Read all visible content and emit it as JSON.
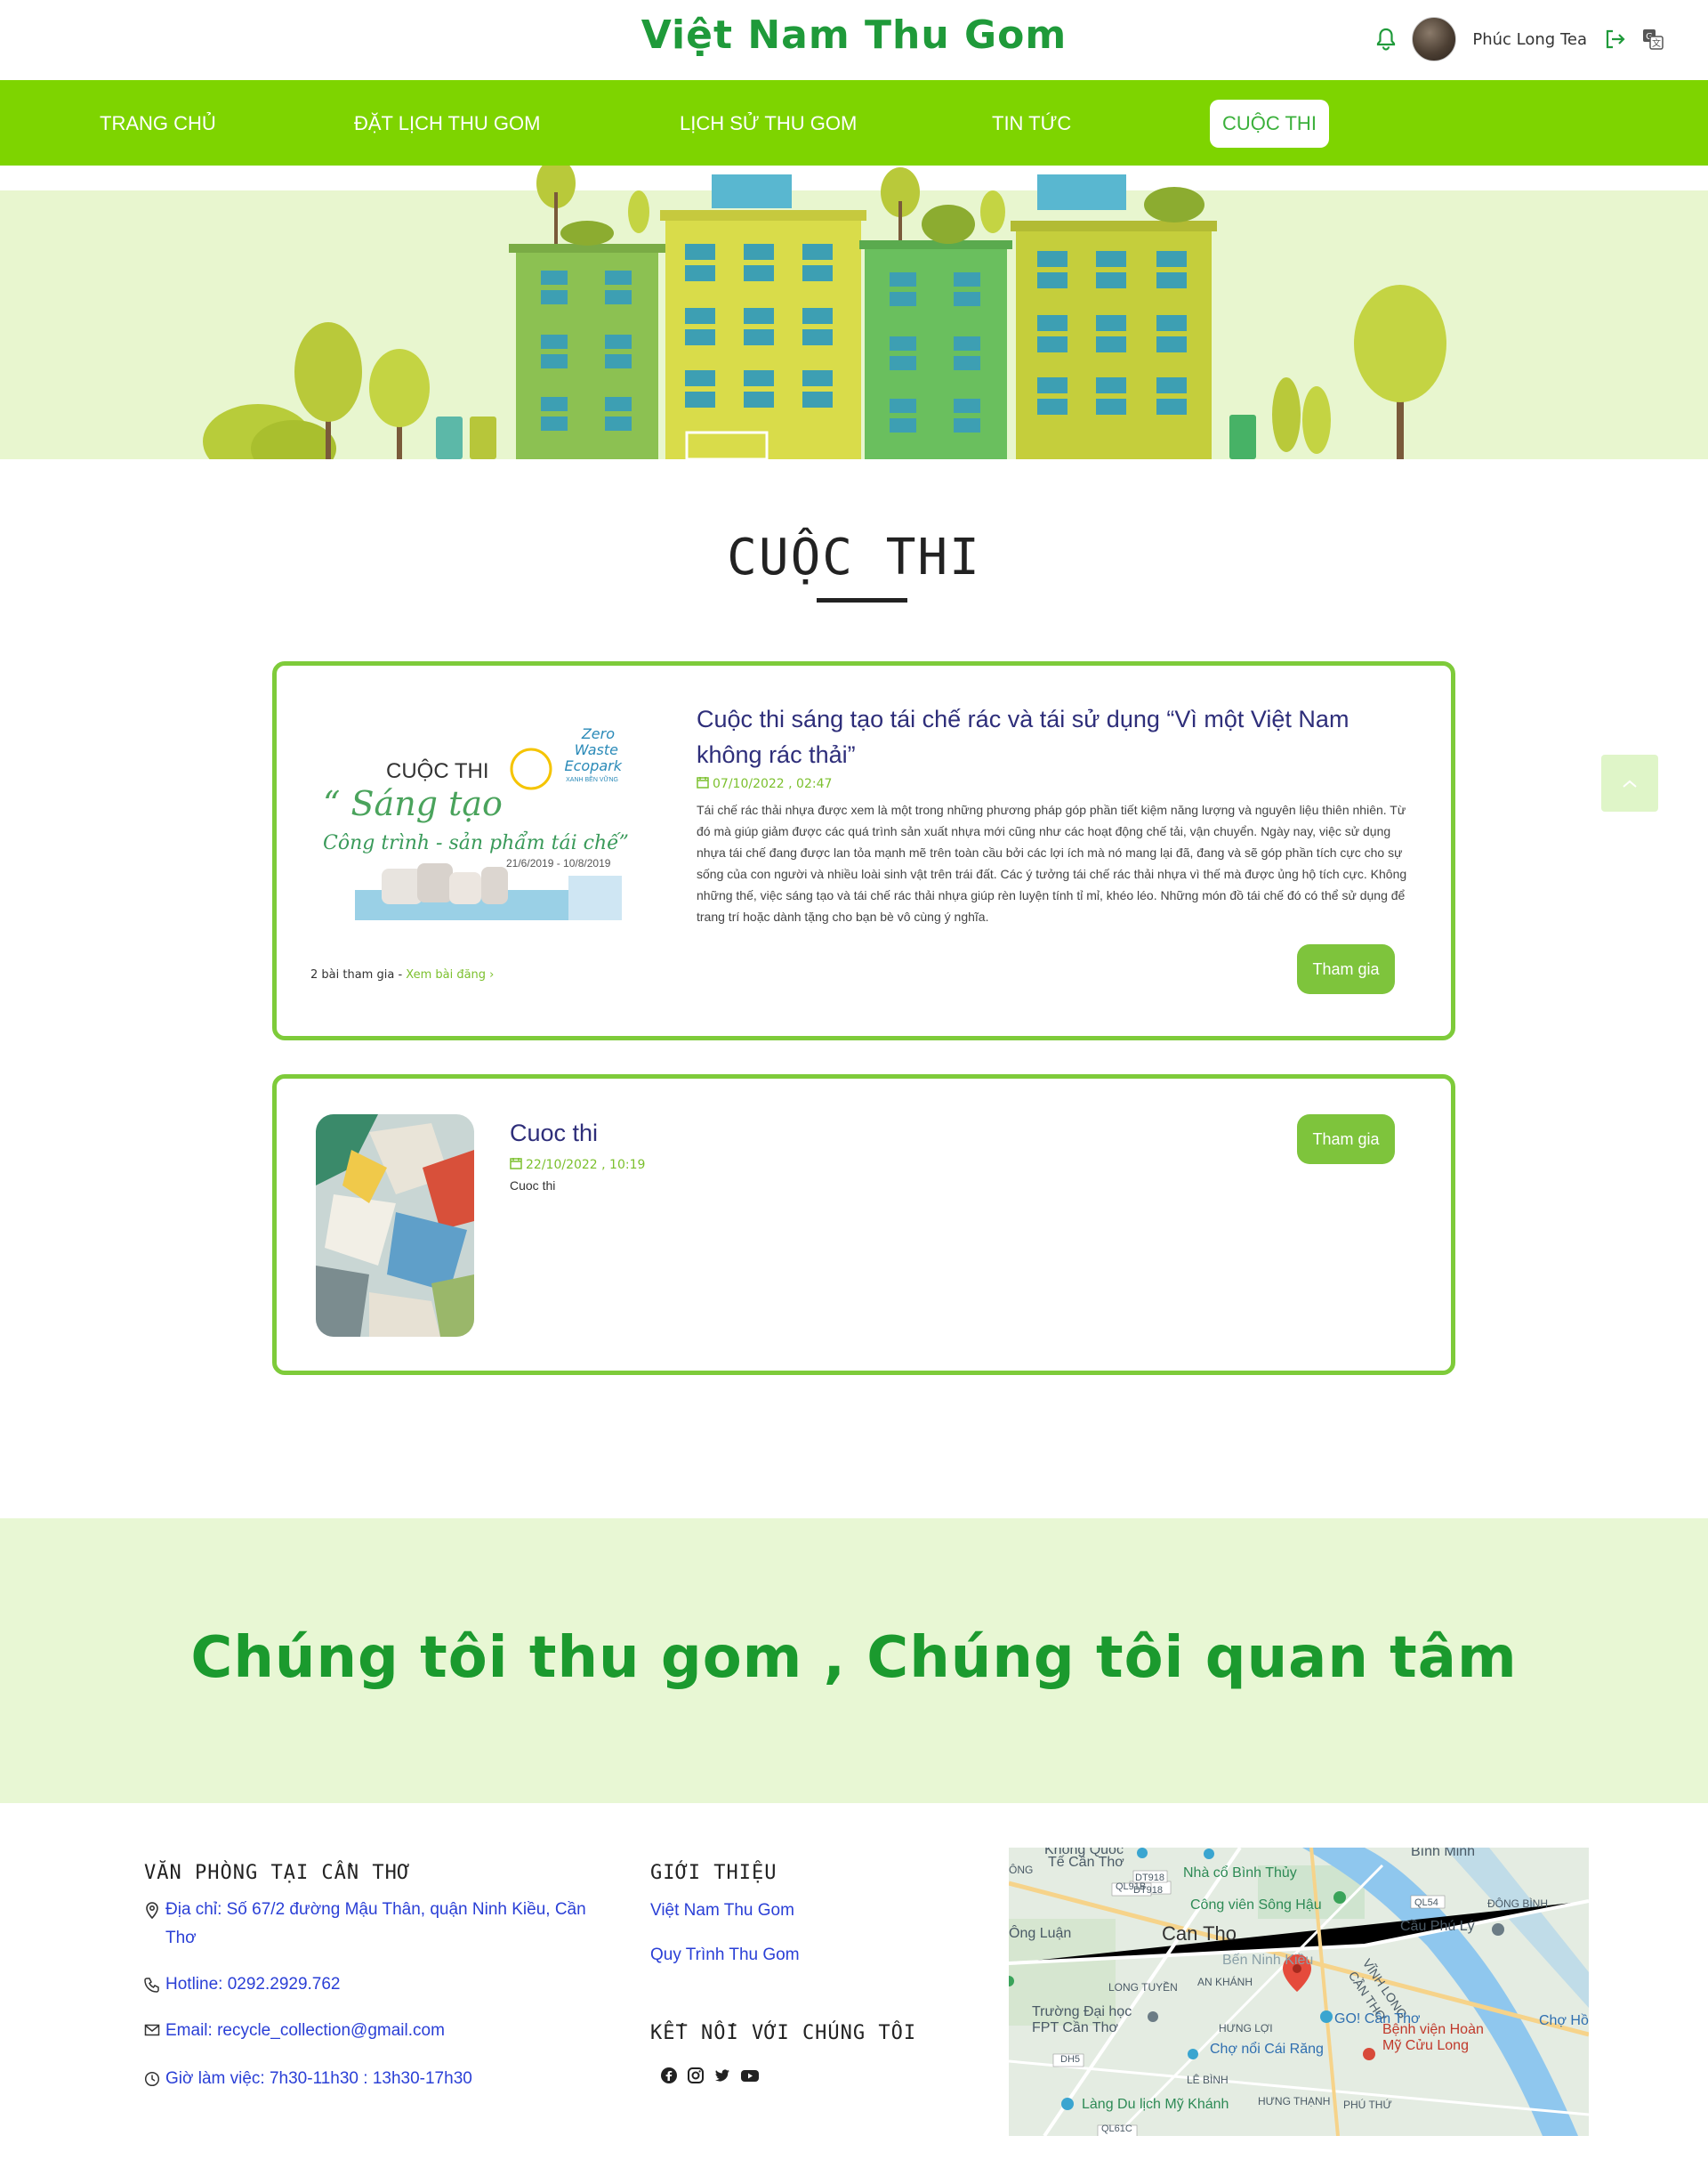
{
  "header": {
    "brand": "Việt Nam Thu Gom",
    "user_name": "Phúc Long Tea"
  },
  "nav": {
    "items": [
      {
        "label": "TRANG CHỦ",
        "active": false
      },
      {
        "label": "ĐẶT LỊCH THU GOM",
        "active": false
      },
      {
        "label": "LỊCH SỬ THU GOM",
        "active": false
      },
      {
        "label": "TIN TỨC",
        "active": false
      },
      {
        "label": "CUỘC THI",
        "active": true
      }
    ]
  },
  "section": {
    "title": "CUỘC THI"
  },
  "contests": [
    {
      "title": "Cuộc thi sáng tạo tái chế rác và tái sử dụng “Vì một Việt Nam không rác thải”",
      "date": "07/10/2022 , 02:47",
      "description": "Tái chế rác thải nhựa được xem là một trong những phương pháp góp phần tiết kiệm năng lượng và nguyên liệu thiên nhiên. Từ đó mà giúp giảm được các quá trình sản xuất nhựa mới cũng như các hoạt động chế tải, vận chuyển. Ngày nay, việc sử dụng nhựa tái chế đang được lan tỏa mạnh mẽ trên toàn cầu bởi các lợi ích mà nó mang lại đã, đang và sẽ góp phần tích cực cho sự sống của con người và nhiều loài sinh vật trên trái đất. Các ý tưởng tái chế rác thải nhựa vì thế mà được ủng hộ tích cực. Không những thế, việc sáng tạo và tái chế rác thải nhựa giúp rèn luyện tính tỉ mỉ, khéo léo. Những món đồ tái chế đó có thể sử dụng để trang trí hoặc dành tặng cho bạn bè vô cùng ý nghĩa.",
      "participants": "2 bài tham gia",
      "view_link": "Xem bài đăng ›",
      "join_label": "Tham gia",
      "poster": {
        "heading": "CUỘC THI",
        "line1": "“ Sáng tạo",
        "line2": "Công trình - sản phẩm tái chế”",
        "dates": "21/6/2019 - 10/8/2019",
        "logo_line1": "Zero",
        "logo_line2": "Waste",
        "logo_line3": "Ecopark",
        "logo_sub": "XANH BỀN VỮNG"
      }
    },
    {
      "title": "Cuoc thi",
      "date": "22/10/2022 , 10:19",
      "description": "Cuoc thi",
      "join_label": "Tham gia"
    }
  ],
  "slogan": "Chúng tôi thu gom , Chúng tôi quan tâm",
  "footer": {
    "office_heading": "VĂN PHÒNG TẠI CẦN THƠ",
    "address": "Địa chỉ: Số 67/2 đường Mậu Thân, quận Ninh Kiều, Cần Thơ",
    "hotline": "Hotline: 0292.2929.762",
    "email": "Email: recycle_collection@gmail.com",
    "hours": "Giờ làm việc: 7h30-11h30 : 13h30-17h30",
    "intro_heading": "GIỚI THIỆU",
    "intro_links": [
      "Việt Nam Thu Gom",
      "Quy Trình Thu Gom"
    ],
    "connect_heading": "KẾT NỐI VỚI CHÚNG TÔI",
    "social_icons": [
      "facebook-icon",
      "instagram-icon",
      "twitter-icon",
      "youtube-icon"
    ],
    "map_labels": {
      "top1": "Khong Quoc",
      "top2": "Tế Cần Thơ",
      "binh_thuy": "Nhà cổ Bình Thủy",
      "binh_minh": "Bình Minh",
      "dong_binh": "ĐÔNG BÌNH",
      "song_hau": "Công viên Sông Hậu",
      "can_tho": "Can Tho",
      "ninh_kieu": "Bến Ninh Kiều",
      "cau_phu_ly": "Cầu Phú Lý",
      "long_tuyen": "LONG TUYỀN",
      "an_khanh": "AN KHÁNH",
      "vinh_long": "VĨNH LONG",
      "can_tho_prov": "CẦN THƠ",
      "dai_hoc": "Trường Đại học FPT Cần Thơ",
      "hung_loi": "HƯNG LỢI",
      "go": "GO! Cần Thơ",
      "benh_vien": "Bệnh viện Hoàn Mỹ Cửu Long",
      "cho_noi": "Chợ nổi Cái Răng",
      "cho_ho": "Chợ Hồ",
      "le_binh": "LÊ BÌNH",
      "lang_du_lich": "Làng Du lịch Mỹ Khánh",
      "hung_thanh": "HƯNG THẠNH",
      "phu_thu": "PHÚ THỨ",
      "ong": "ÔNG",
      "ong_luan": "Ông Luận",
      "ql91b": "QL91B",
      "dt918a": "DT918",
      "dt918b": "DT918",
      "ql54": "QL54",
      "dh5": "DH5",
      "ql61c": "QL61C"
    }
  }
}
